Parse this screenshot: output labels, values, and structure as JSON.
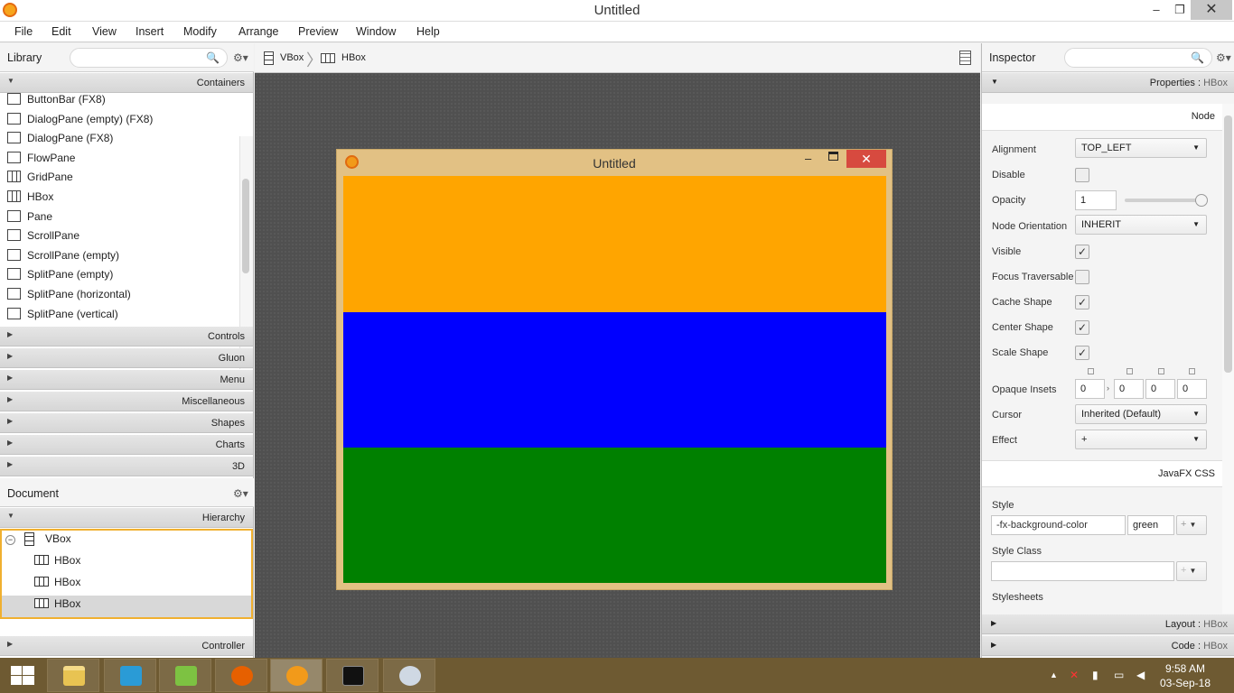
{
  "window": {
    "title": "Untitled"
  },
  "menu": [
    "File",
    "Edit",
    "View",
    "Insert",
    "Modify",
    "Arrange",
    "Preview",
    "Window",
    "Help"
  ],
  "library": {
    "title": "Library",
    "containers_label": "Containers",
    "items": [
      "ButtonBar  (FX8)",
      "DialogPane (empty)  (FX8)",
      "DialogPane  (FX8)",
      "FlowPane",
      "GridPane",
      "HBox",
      "Pane",
      "ScrollPane",
      "ScrollPane  (empty)",
      "SplitPane  (empty)",
      "SplitPane  (horizontal)",
      "SplitPane  (vertical)"
    ],
    "sections": [
      "Controls",
      "Gluon",
      "Menu",
      "Miscellaneous",
      "Shapes",
      "Charts",
      "3D"
    ]
  },
  "document": {
    "title": "Document",
    "hierarchy_label": "Hierarchy",
    "tree": [
      "VBox",
      "HBox",
      "HBox",
      "HBox"
    ],
    "controller_label": "Controller"
  },
  "breadcrumb": [
    "VBox",
    "HBox"
  ],
  "stage": {
    "title": "Untitled",
    "bands": [
      "#ffa500",
      "#0000ff",
      "#008000"
    ]
  },
  "inspector": {
    "title": "Inspector",
    "properties_label": "Properties",
    "properties_target": "HBox",
    "node_label": "Node",
    "alignment_label": "Alignment",
    "alignment_value": "TOP_LEFT",
    "disable_label": "Disable",
    "opacity_label": "Opacity",
    "opacity_value": "1",
    "orientation_label": "Node Orientation",
    "orientation_value": "INHERIT",
    "visible_label": "Visible",
    "focus_label": "Focus Traversable",
    "cache_label": "Cache Shape",
    "center_label": "Center Shape",
    "scale_label": "Scale Shape",
    "insets_label": "Opaque Insets",
    "insets": [
      "0",
      "0",
      "0",
      "0"
    ],
    "cursor_label": "Cursor",
    "cursor_value": "Inherited (Default)",
    "effect_label": "Effect",
    "effect_value": "+",
    "css_label": "JavaFX CSS",
    "style_label": "Style",
    "style_prop": "-fx-background-color",
    "style_value": "green",
    "styleclass_label": "Style Class",
    "stylesheets_label": "Stylesheets",
    "layout_label": "Layout",
    "layout_target": "HBox",
    "code_label": "Code",
    "code_target": "HBox"
  },
  "taskbar": {
    "time": "9:58 AM",
    "date": "03-Sep-18"
  }
}
